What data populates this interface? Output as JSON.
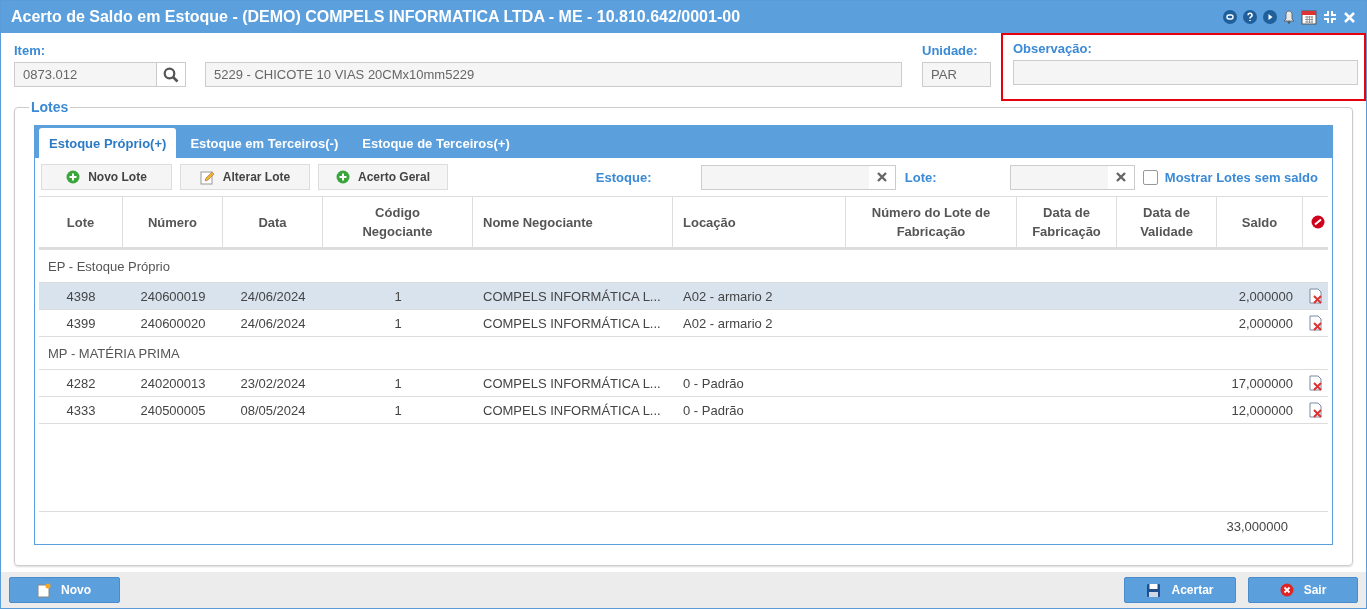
{
  "window": {
    "title": "Acerto de Saldo em Estoque - (DEMO) COMPELS INFORMATICA LTDA - ME - 10.810.642/0001-00"
  },
  "item": {
    "label": "Item:",
    "value": "0873.012",
    "description": "5229 - CHICOTE 10 VIAS 20CMx10mm5229"
  },
  "unidade": {
    "label": "Unidade:",
    "value": "PAR"
  },
  "observacao": {
    "label": "Observação:",
    "highlighted": true
  },
  "lotes": {
    "legend": "Lotes",
    "tabs": [
      {
        "label": "Estoque Próprio(+)",
        "selected": true
      },
      {
        "label": "Estoque em Terceiros(-)",
        "selected": false
      },
      {
        "label": "Estoque de Terceiros(+)",
        "selected": false
      }
    ],
    "toolbar": [
      {
        "label": "Novo Lote",
        "kind": "add"
      },
      {
        "label": "Alterar Lote",
        "kind": "edit"
      },
      {
        "label": "Acerto Geral",
        "kind": "add"
      }
    ],
    "filters": [
      {
        "label": "Estoque:"
      },
      {
        "label": "Lote:"
      }
    ],
    "show_without_balance": {
      "label": "Mostrar Lotes sem saldo",
      "checked": false
    },
    "columns": [
      "Lote",
      "Número",
      "Data",
      "Código Negociante",
      "Nome Negociante",
      "Locação",
      "Número do Lote de Fabricação",
      "Data de Fabricação",
      "Data de Validade",
      "Saldo"
    ],
    "groups": [
      {
        "title": "EP - Estoque Próprio",
        "rows": [
          {
            "lote": "4398",
            "numero": "240600019",
            "data": "24/06/2024",
            "codigo": "1",
            "nome": "COMPELS INFORMÁTICA L...",
            "locacao": "A02 - armario 2",
            "saldo": "2,000000",
            "selected": true
          },
          {
            "lote": "4399",
            "numero": "240600020",
            "data": "24/06/2024",
            "codigo": "1",
            "nome": "COMPELS INFORMÁTICA L...",
            "locacao": "A02 - armario 2",
            "saldo": "2,000000",
            "selected": false
          }
        ]
      },
      {
        "title": "MP - MATÉRIA PRIMA",
        "rows": [
          {
            "lote": "4282",
            "numero": "240200013",
            "data": "23/02/2024",
            "codigo": "1",
            "nome": "COMPELS INFORMÁTICA L...",
            "locacao": "0 - Padrão",
            "saldo": "17,000000",
            "selected": false
          },
          {
            "lote": "4333",
            "numero": "240500005",
            "data": "08/05/2024",
            "codigo": "1",
            "nome": "COMPELS INFORMÁTICA L...",
            "locacao": "0 - Padrão",
            "saldo": "12,000000",
            "selected": false
          }
        ]
      }
    ],
    "total": "33,000000"
  },
  "buttons": [
    {
      "label": "Novo",
      "kind": "new"
    },
    {
      "label": "Acertar",
      "kind": "save"
    },
    {
      "label": "Sair",
      "kind": "exit"
    }
  ]
}
